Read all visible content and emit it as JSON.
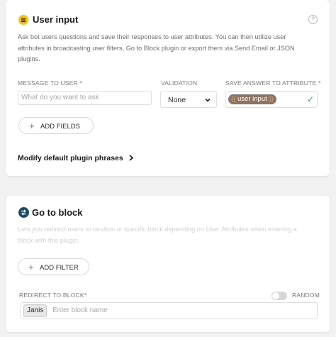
{
  "user_input": {
    "title": "User input",
    "help_glyph": "?",
    "description": "Ask bot users questions and save their responses to user attributes. You can then utilize user attributes in broadcasting user filters, Go to Block plugin or export them via Send Email or JSON plugins.",
    "message_label": "MESSAGE TO USER",
    "required_mark": "*",
    "message_placeholder": "What do you want to ask",
    "validation_label": "VALIDATION",
    "validation_value": "None",
    "save_label": "SAVE ANSWER TO ATTRIBUTE",
    "attribute_open": "{{",
    "attribute_value": "user input",
    "attribute_close": "}}",
    "add_fields_label": "ADD FIELDS",
    "modify_link": "Modify default plugin phrases",
    "icon_color": "#f2c21b"
  },
  "go_to_block": {
    "title": "Go to block",
    "description": "Lets you redirect users to random or specific block depending on User Attributes when entering a block with this plugin.",
    "add_filter_label": "ADD FILTER",
    "redirect_label": "REDIRECT TO BLOCK",
    "random_label": "RANDOM",
    "random_enabled": false,
    "block_tag": "Janis",
    "block_placeholder": "Enter block name",
    "icon_color": "#1b4b63"
  }
}
